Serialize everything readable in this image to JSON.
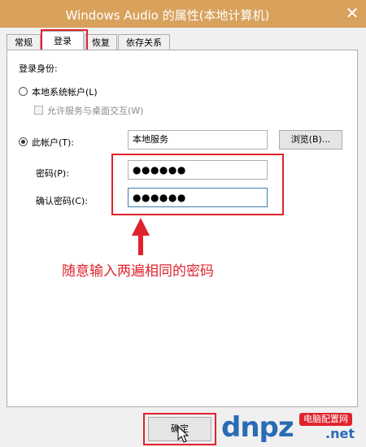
{
  "window": {
    "title": "Windows Audio 的属性(本地计算机)",
    "close_glyph": "✕"
  },
  "tabs": [
    {
      "label": "常规"
    },
    {
      "label": "登录",
      "active": true
    },
    {
      "label": "恢复"
    },
    {
      "label": "依存关系"
    }
  ],
  "logon": {
    "group_label": "登录身份:",
    "local_system_label": "本地系统帐户(L)",
    "interact_label": "允许服务与桌面交互(W)",
    "this_account_label": "此帐户(T):",
    "account_value": "本地服务",
    "browse_label": "浏览(B)...",
    "password_label": "密码(P):",
    "password_value": "●●●●●●",
    "confirm_label": "确认密码(C):",
    "confirm_value": "●●●●●●"
  },
  "annotation": {
    "text": "随意输入两遍相同的密码",
    "color": "#e0222d"
  },
  "footer": {
    "ok_label": "确定"
  },
  "watermark": {
    "main": "dnpz",
    "suffix": ".net",
    "badge": "电脑配置网"
  },
  "colors": {
    "accent_red": "#e0222d",
    "titlebar": "#d8a15c",
    "logo_blue": "#2a6bb5"
  },
  "icons": [
    "close-icon",
    "radio-icon",
    "checkbox-icon",
    "arrow-up-icon",
    "mouse-cursor-icon"
  ]
}
